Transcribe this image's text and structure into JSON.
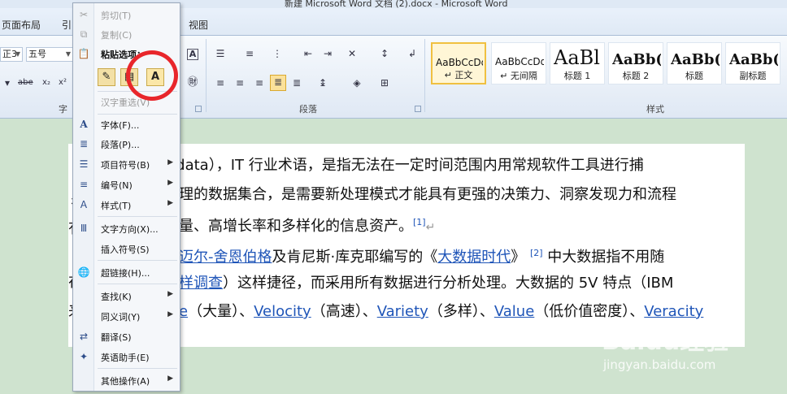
{
  "window": {
    "title": "新建 Microsoft Word 文档 (2).docx - Microsoft Word"
  },
  "tabs": [
    "页面布局",
    "引",
    "视图"
  ],
  "ribbon": {
    "font_name": "正3",
    "font_size": "五号",
    "group_font": "字",
    "group_paragraph": "段落",
    "group_styles": "样式"
  },
  "styles": [
    {
      "sample": "AaBbCcDd",
      "name": "↵ 正文"
    },
    {
      "sample": "AaBbCcDd",
      "name": "↵ 无间隔"
    },
    {
      "sample": "AaBl",
      "name": "标题 1"
    },
    {
      "sample": "AaBb(",
      "name": "标题 2"
    },
    {
      "sample": "AaBb(",
      "name": "标题"
    },
    {
      "sample": "AaBb(",
      "name": "副标题"
    }
  ],
  "context_menu": {
    "cut": "剪切(T)",
    "copy": "复制(C)",
    "paste_options": "粘贴选项：",
    "hanzi": "汉字重选(V)",
    "font": "字体(F)...",
    "paragraph": "段落(P)...",
    "bullets": "项目符号(B)",
    "numbering": "编号(N)",
    "styles": "样式(T)",
    "text_direction": "文字方向(X)...",
    "insert_symbol": "插入符号(S)",
    "hyperlink": "超链接(H)...",
    "lookup": "查找(K)",
    "synonyms": "同义词(Y)",
    "translate": "翻译(S)",
    "english_assistant": "英语助手(E)",
    "other": "其他操作(A)"
  },
  "document": {
    "l1": "ig data），IT 行业术语，是指无法在一定时间范围内用常规软件工具进行捕",
    "l2": "理的数据集合，是需要新处理模式才能具有更强的决策力、洞察发现力和流程",
    "l3": "量、高增长率和多样化的信息资产。",
    "fn1": "[1]",
    "l4_link": "迈尔-舍恩伯格",
    "l4_a": "及肯尼斯·库克耶编写的《",
    "l4_link2": "大数据时代",
    "l4_b": "》",
    "fn2": "[2]",
    "l4_c": " 中大数据指不用随",
    "l5_link": "样调查",
    "l5": "）这样捷径，而采用所有数据进行分析处理。大数据的 5V 特点（IBM",
    "l6_e": "e",
    "l6_a": "（大量）、",
    "velocity": "Velocity",
    "l6_b": "（高速）、",
    "variety": "Variety",
    "l6_c": "（多样）、",
    "value": "Value",
    "l6_d": "（低价值密度）、",
    "veracity": "Veracity",
    "left_chars": [
      "征",
      "彳",
      "有",
      "在",
      "来"
    ]
  },
  "watermark": {
    "brand": "Baidu经验",
    "url": "jingyan.baidu.com"
  }
}
